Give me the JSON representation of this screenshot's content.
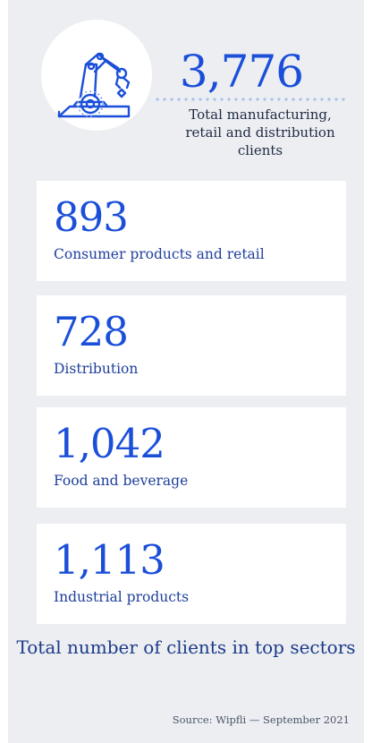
{
  "hero": {
    "number": "3,776",
    "caption_lines": [
      "Total manufacturing,",
      "retail and distribution",
      "clients"
    ],
    "icon": "robotic-arm-icon"
  },
  "sectors": [
    {
      "value": "893",
      "label": "Consumer products and retail"
    },
    {
      "value": "728",
      "label": "Distribution"
    },
    {
      "value": "1,042",
      "label": "Food and beverage"
    },
    {
      "value": "1,113",
      "label": "Industrial products"
    }
  ],
  "footer": {
    "title": "Total number of clients in top sectors",
    "source": "Source: Wipfli — September 2021"
  },
  "colors": {
    "accent": "#1b4fd9",
    "background": "#eceef1",
    "card": "#ffffff",
    "dots": "#a8c1e8"
  }
}
